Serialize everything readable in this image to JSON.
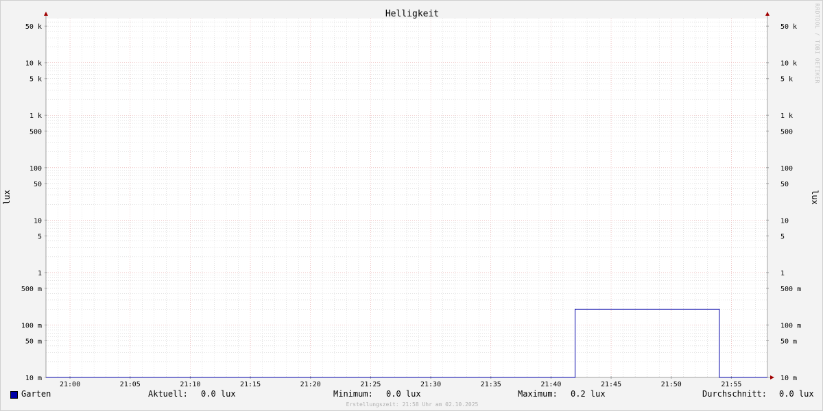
{
  "chart_data": {
    "type": "line",
    "title": "Helligkeit",
    "ylabel_left": "lux",
    "ylabel_right": "lux",
    "y_scale": "log",
    "ylim": [
      0.01,
      70000
    ],
    "x_ticks": [
      "21:00",
      "21:05",
      "21:10",
      "21:15",
      "21:20",
      "21:25",
      "21:30",
      "21:35",
      "21:40",
      "21:45",
      "21:50",
      "21:55"
    ],
    "xlim": [
      "20:58",
      "21:58"
    ],
    "y_ticks": [
      {
        "value": 0.01,
        "label": "10 m"
      },
      {
        "value": 0.05,
        "label": "50 m"
      },
      {
        "value": 0.1,
        "label": "100 m"
      },
      {
        "value": 0.5,
        "label": "500 m"
      },
      {
        "value": 1,
        "label": "1"
      },
      {
        "value": 5,
        "label": "5"
      },
      {
        "value": 10,
        "label": "10"
      },
      {
        "value": 50,
        "label": "50"
      },
      {
        "value": 100,
        "label": "100"
      },
      {
        "value": 500,
        "label": "500"
      },
      {
        "value": 1000,
        "label": "1 k"
      },
      {
        "value": 5000,
        "label": "5 k"
      },
      {
        "value": 10000,
        "label": "10 k"
      },
      {
        "value": 50000,
        "label": "50 k"
      }
    ],
    "grid": true,
    "series": [
      {
        "name": "Garten",
        "color": "#0000a8",
        "points": [
          {
            "x": "20:58",
            "y": 0.01
          },
          {
            "x": "21:42",
            "y": 0.01
          },
          {
            "x": "21:42",
            "y": 0.2
          },
          {
            "x": "21:54",
            "y": 0.2
          },
          {
            "x": "21:54",
            "y": 0.01
          },
          {
            "x": "21:58",
            "y": 0.01
          }
        ]
      }
    ]
  },
  "legend": {
    "series_name": "Garten",
    "aktuell_label": "Aktuell:",
    "aktuell_value": "0.0 lux",
    "minimum_label": "Minimum:",
    "minimum_value": "0.0 lux",
    "maximum_label": "Maximum:",
    "maximum_value": "0.2 lux",
    "avg_label": "Durchschnitt:",
    "avg_value": "0.0 lux"
  },
  "footer": {
    "credit": "Erstellungszeit: 21:58 Uhr am 02.10.2025",
    "watermark": "RRDTOOL / TOBI OETIKER"
  },
  "colors": {
    "major_grid": "#e6a0a0",
    "minor_grid": "#c8c8c8",
    "axis": "#a0a0a0",
    "arrow": "#a00000"
  }
}
